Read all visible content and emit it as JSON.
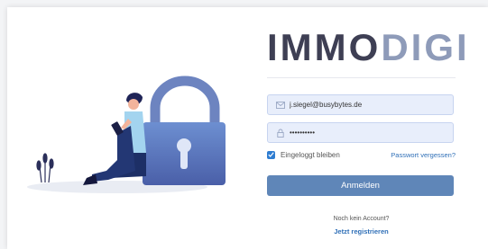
{
  "brand": {
    "part1": "IMMO",
    "part2": "DIGI"
  },
  "login": {
    "email": {
      "value": "j.siegel@busybytes.de",
      "icon": "mail-icon"
    },
    "password": {
      "value": "••••••••••",
      "icon": "lock-icon"
    },
    "remember": {
      "label": "Eingeloggt bleiben",
      "checked": true
    },
    "forgot_link": "Passwort vergessen?",
    "submit_label": "Anmelden"
  },
  "signup": {
    "question": "Noch kein Account?",
    "link": "Jetzt registrieren"
  },
  "colors": {
    "brand_dark": "#3e3f54",
    "brand_light": "#8e9bb9",
    "button": "#5f86b8",
    "link": "#2f6fb7"
  }
}
